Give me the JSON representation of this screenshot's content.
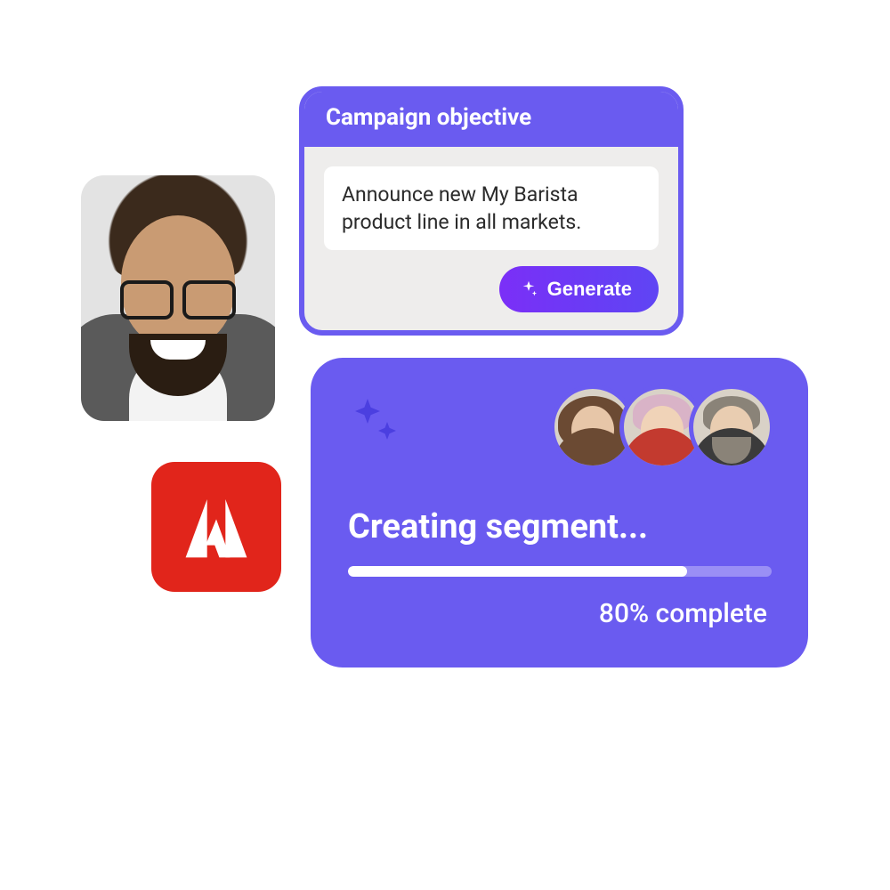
{
  "campaign": {
    "header": "Campaign objective",
    "objective_text": "Announce new My Barista product line in all markets.",
    "generate_label": "Generate"
  },
  "progress": {
    "title": "Creating segment...",
    "percent": 80,
    "percent_label": "80% complete"
  },
  "icons": {
    "sparkle": "sparkle-icon",
    "adobe": "adobe-logo"
  },
  "colors": {
    "brand_purple": "#6a5bf0",
    "adobe_red": "#e1251b",
    "gradient_start": "#7b2ff7",
    "gradient_end": "#5f45f4"
  },
  "avatars": [
    "team-member-1",
    "team-member-2",
    "team-member-3"
  ]
}
